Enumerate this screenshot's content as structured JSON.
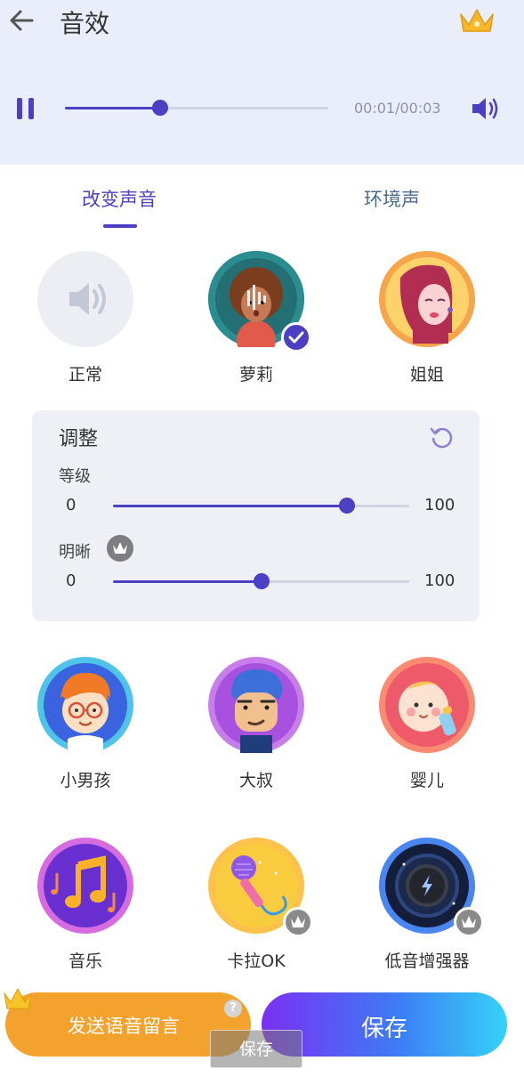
{
  "header": {
    "title": "音效"
  },
  "player": {
    "time": "00:01/00:03",
    "progress": 0.36
  },
  "tabs": [
    {
      "label": "改变声音",
      "active": true
    },
    {
      "label": "环境声",
      "active": false
    }
  ],
  "voices_row1": [
    {
      "label": "正常",
      "icon": "speaker-icon"
    },
    {
      "label": "萝莉",
      "icon": "loli-avatar",
      "selected": true
    },
    {
      "label": "姐姐",
      "icon": "sister-avatar"
    }
  ],
  "adjust": {
    "title": "调整",
    "level": {
      "label": "等级",
      "min": "0",
      "max": "100",
      "value": 0.79
    },
    "clarity": {
      "label": "明晰",
      "min": "0",
      "max": "100",
      "value": 0.5,
      "premium": true
    }
  },
  "voices_row2": [
    {
      "label": "小男孩",
      "icon": "boy-avatar"
    },
    {
      "label": "大叔",
      "icon": "uncle-avatar"
    },
    {
      "label": "婴儿",
      "icon": "baby-avatar"
    }
  ],
  "voices_row3": [
    {
      "label": "音乐",
      "icon": "music-avatar"
    },
    {
      "label": "卡拉OK",
      "icon": "karaoke-avatar",
      "premium": true
    },
    {
      "label": "低音增强器",
      "icon": "bass-avatar",
      "premium": true
    }
  ],
  "bottom": {
    "voice_message_label": "发送语音留言",
    "save_label": "保存",
    "toast_label": "保存"
  },
  "colors": {
    "accent": "#4b3fc4",
    "orange": "#f3a22d",
    "header_bg": "#eaeefa"
  }
}
